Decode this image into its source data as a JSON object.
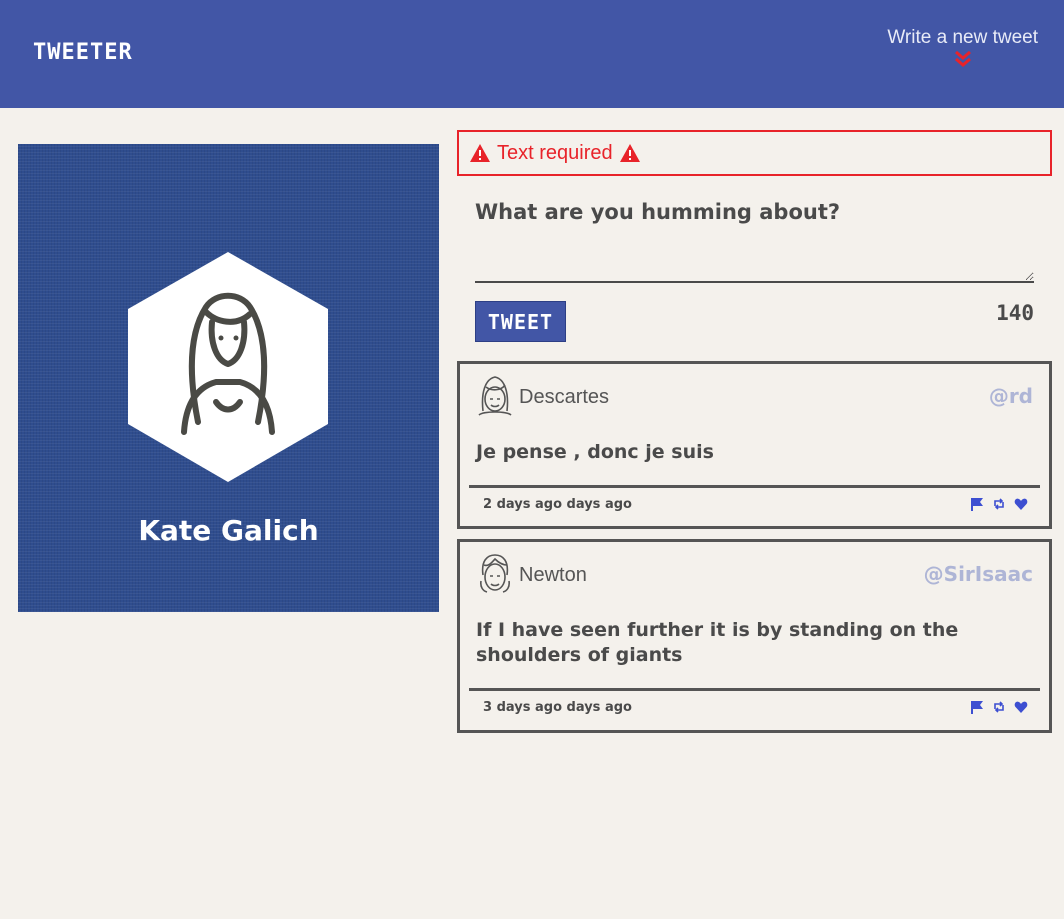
{
  "header": {
    "brand": "TWEETER",
    "compose_label": "Write a new tweet",
    "compose_icon": "double-chevron-down-icon",
    "bg_color": "#4256a6",
    "accent_color": "#e8232a"
  },
  "profile": {
    "name": "Kate Galich",
    "avatar_icon": "woman-avatar-icon"
  },
  "composer": {
    "error_text": "Text required",
    "placeholder": "What are you humming about?",
    "value": "",
    "button_label": "TWEET",
    "counter": "140"
  },
  "tweets": [
    {
      "name": "Descartes",
      "handle": "@rd",
      "text": "Je pense , donc je suis",
      "time": "2 days ago days ago",
      "avatar_icon": "girl-avatar-icon"
    },
    {
      "name": "Newton",
      "handle": "@SirIsaac",
      "text": "If I have seen further it is by standing on the shoulders of giants",
      "time": "3 days ago days ago",
      "avatar_icon": "man-avatar-icon"
    }
  ]
}
